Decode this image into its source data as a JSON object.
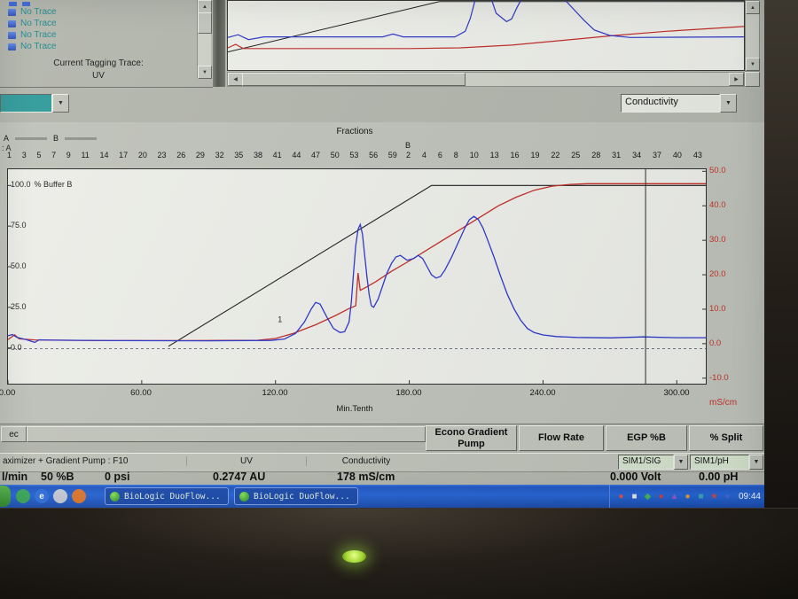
{
  "top_left_panel": {
    "items": [
      "No Trace",
      "No Trace",
      "No Trace",
      "No Trace"
    ],
    "tagging_label": "Current Tagging Trace:",
    "tagging_value": "UV"
  },
  "combos": {
    "left_value": "",
    "right_value": "Conductivity"
  },
  "main_chart": {
    "title": "Fractions",
    "legend_a": "A",
    "legend_b": "B",
    "rack_a_label": ": A",
    "rack_b_label": "B",
    "fractions_a": [
      "1",
      "3",
      "5",
      "7",
      "9",
      "11",
      "14",
      "17",
      "20",
      "23",
      "26",
      "29",
      "32",
      "35",
      "38",
      "41",
      "44",
      "47",
      "50",
      "53",
      "56",
      "59"
    ],
    "fractions_b": [
      "2",
      "4",
      "6",
      "8",
      "10",
      "13",
      "16",
      "19",
      "22",
      "25",
      "28",
      "31",
      "34",
      "37",
      "40",
      "43"
    ],
    "left_axis_top_value": "100.0",
    "left_axis_unit": "% Buffer B",
    "left_tick_75": "75.0",
    "left_tick_50": "50.0",
    "left_tick_25": "25.0",
    "left_tick_0": "0.0",
    "right_ticks": [
      "50.0",
      "40.0",
      "30.0",
      "20.0",
      "10.0",
      "0.0",
      "-10.0"
    ],
    "right_unit": "mS/cm",
    "x_ticks": [
      "0.00",
      "60.00",
      "120.00",
      "180.00",
      "240.00",
      "300.00"
    ],
    "x_label": "Min.Tenth"
  },
  "chart_data": [
    {
      "type": "line",
      "title": "Fractions",
      "x_label": "Min.Tenth",
      "x_range": [
        0,
        313
      ],
      "x_ticks": [
        0,
        60,
        120,
        180,
        240,
        300
      ],
      "left_axis": {
        "label": "% Buffer B",
        "range": [
          -22,
          110
        ],
        "ticks": [
          100,
          75,
          50,
          25,
          0
        ]
      },
      "right_axis": {
        "label": "mS/cm",
        "range": [
          -11.6,
          50.6
        ],
        "ticks": [
          50,
          40,
          30,
          20,
          10,
          0,
          -10
        ]
      },
      "series": [
        {
          "name": "buffer-b-gradient",
          "axis": "left",
          "color": "#1a1a1a",
          "width": 1.1,
          "points": [
            [
              72,
              1
            ],
            [
              190,
              100
            ],
            [
              313,
              100
            ]
          ]
        },
        {
          "name": "conductivity",
          "axis": "right",
          "color": "#c22a24",
          "width": 1.3,
          "points": [
            [
              0,
              1.2
            ],
            [
              3,
              2.6
            ],
            [
              5,
              1.4
            ],
            [
              12,
              1.1
            ],
            [
              40,
              0.9
            ],
            [
              80,
              0.9
            ],
            [
              112,
              1
            ],
            [
              120,
              1.5
            ],
            [
              128,
              3
            ],
            [
              138,
              5.5
            ],
            [
              147,
              8.2
            ],
            [
              153,
              10.2
            ],
            [
              156,
              11
            ],
            [
              157,
              20.5
            ],
            [
              158,
              15.5
            ],
            [
              161,
              16.5
            ],
            [
              165,
              18
            ],
            [
              172,
              21
            ],
            [
              180,
              24
            ],
            [
              190,
              28
            ],
            [
              200,
              32
            ],
            [
              210,
              36
            ],
            [
              220,
              40
            ],
            [
              228,
              42.5
            ],
            [
              236,
              44.5
            ],
            [
              244,
              45.7
            ],
            [
              252,
              46.2
            ],
            [
              260,
              46.4
            ],
            [
              313,
              46.4
            ]
          ]
        },
        {
          "name": "uv",
          "axis": "left",
          "color": "#2b35c8",
          "width": 1.3,
          "points": [
            [
              0,
              7.5
            ],
            [
              2,
              8.2
            ],
            [
              4,
              6.5
            ],
            [
              8,
              5.2
            ],
            [
              12,
              3.4
            ],
            [
              14,
              5
            ],
            [
              20,
              4.8
            ],
            [
              50,
              4.5
            ],
            [
              90,
              4.4
            ],
            [
              118,
              4.6
            ],
            [
              124,
              5.5
            ],
            [
              129,
              9
            ],
            [
              133,
              16
            ],
            [
              136,
              24
            ],
            [
              138,
              28
            ],
            [
              140,
              27
            ],
            [
              143,
              19
            ],
            [
              146,
              12
            ],
            [
              149,
              9.5
            ],
            [
              151,
              10
            ],
            [
              153,
              16
            ],
            [
              154,
              28
            ],
            [
              155,
              46
            ],
            [
              156,
              63
            ],
            [
              157,
              73
            ],
            [
              158,
              76
            ],
            [
              159,
              70
            ],
            [
              160,
              57
            ],
            [
              161,
              44
            ],
            [
              162,
              33
            ],
            [
              163,
              26
            ],
            [
              164,
              25
            ],
            [
              166,
              30
            ],
            [
              168,
              38
            ],
            [
              170,
              46
            ],
            [
              172,
              52
            ],
            [
              174,
              56
            ],
            [
              176,
              57
            ],
            [
              179,
              54
            ],
            [
              182,
              55
            ],
            [
              184,
              57
            ],
            [
              186,
              55
            ],
            [
              188,
              50
            ],
            [
              190,
              45
            ],
            [
              192,
              43
            ],
            [
              194,
              44
            ],
            [
              196,
              48
            ],
            [
              199,
              56
            ],
            [
              202,
              65
            ],
            [
              205,
              74
            ],
            [
              207,
              79
            ],
            [
              209,
              81
            ],
            [
              211,
              79
            ],
            [
              213,
              74
            ],
            [
              215,
              67
            ],
            [
              218,
              56
            ],
            [
              221,
              44
            ],
            [
              224,
              33
            ],
            [
              227,
              24
            ],
            [
              230,
              17
            ],
            [
              233,
              12
            ],
            [
              236,
              9.5
            ],
            [
              240,
              8
            ],
            [
              246,
              7
            ],
            [
              255,
              6.5
            ],
            [
              270,
              6.2
            ],
            [
              285,
              6.8
            ],
            [
              300,
              6.3
            ],
            [
              313,
              6.3
            ]
          ]
        },
        {
          "name": "zero-baseline",
          "axis": "left",
          "color": "#464c68",
          "width": 0.8,
          "dash": "3,3",
          "points": [
            [
              0,
              -0.5
            ],
            [
              313,
              -0.5
            ]
          ]
        },
        {
          "name": "cursor-line",
          "axis": "left",
          "color": "#2a2a2a",
          "width": 1,
          "points": [
            [
              286,
              -22
            ],
            [
              286,
              110
            ]
          ]
        }
      ],
      "annotations": [
        {
          "x": 121,
          "y": 16,
          "text": "1",
          "color": "#222222"
        }
      ]
    },
    {
      "type": "line",
      "title": "overview",
      "x_range": [
        0,
        100
      ],
      "left_axis": {
        "range": [
          100,
          0
        ]
      },
      "series": [
        {
          "name": "gradient",
          "color": "#1a1a1a",
          "width": 1,
          "points": [
            [
              0,
              74
            ],
            [
              41,
              1
            ],
            [
              100,
              1
            ]
          ]
        },
        {
          "name": "conductivity",
          "color": "#c22a24",
          "width": 1.2,
          "points": [
            [
              0,
              68
            ],
            [
              1.5,
              63
            ],
            [
              3,
              69
            ],
            [
              35,
              69
            ],
            [
              45,
              68
            ],
            [
              55,
              64
            ],
            [
              65,
              57
            ],
            [
              75,
              50
            ],
            [
              85,
              44
            ],
            [
              100,
              37
            ]
          ]
        },
        {
          "name": "uv",
          "color": "#2b35c8",
          "width": 1.2,
          "points": [
            [
              0,
              53
            ],
            [
              2,
              49
            ],
            [
              4,
              56
            ],
            [
              7,
              52
            ],
            [
              30,
              52
            ],
            [
              32,
              48
            ],
            [
              34,
              52
            ],
            [
              44,
              52
            ],
            [
              46,
              44
            ],
            [
              47,
              25
            ],
            [
              48,
              -4
            ],
            [
              51,
              -4
            ],
            [
              52,
              18
            ],
            [
              54,
              30
            ],
            [
              55,
              26
            ],
            [
              56,
              10
            ],
            [
              57,
              -4
            ],
            [
              65,
              -4
            ],
            [
              67,
              12
            ],
            [
              69,
              28
            ],
            [
              71,
              42
            ],
            [
              74,
              50
            ],
            [
              78,
              53
            ],
            [
              100,
              52
            ]
          ]
        }
      ]
    }
  ],
  "status_panel": {
    "tab_label": "ec",
    "headers": [
      "Econo Gradient Pump",
      "Flow Rate",
      "EGP %B",
      "% Split"
    ],
    "device_pump": "aximizer + Gradient Pump : F10",
    "device_uv": "UV",
    "device_cond": "Conductivity",
    "sim_sig": "SIM1/SIG",
    "sim_ph": "SIM1/pH",
    "value_flow_unit": "l/min",
    "value_percent_b": "50 %B",
    "value_pressure": "0 psi",
    "value_uv": "0.2747 AU",
    "value_cond": "178 mS/cm",
    "value_volt": "0.000 Volt",
    "value_ph": "0.00 pH"
  },
  "taskbar": {
    "window_buttons": [
      "BioLogic DuoFlow...",
      "BioLogic DuoFlow..."
    ],
    "clock": "09:44",
    "quick_launch_icons": [
      {
        "name": "quick-launch-icon",
        "glyph": "●",
        "color": "#3aa85c"
      },
      {
        "name": "ie-icon",
        "glyph": "e",
        "color": "#3070dc"
      },
      {
        "name": "quick-launch-icon",
        "glyph": "■",
        "color": "#c8ccd8"
      },
      {
        "name": "quick-launch-icon",
        "glyph": "●",
        "color": "#e07830"
      }
    ],
    "tray_icons": [
      {
        "name": "tray-icon",
        "glyph": "●",
        "color": "#e05050"
      },
      {
        "name": "tray-icon",
        "glyph": "■",
        "color": "#e8e8ee"
      },
      {
        "name": "tray-icon",
        "glyph": "◆",
        "color": "#48b858"
      },
      {
        "name": "tray-icon",
        "glyph": "●",
        "color": "#d04040"
      },
      {
        "name": "tray-icon",
        "glyph": "▲",
        "color": "#9858c8"
      },
      {
        "name": "tray-icon",
        "glyph": "●",
        "color": "#e8a030"
      },
      {
        "name": "tray-icon",
        "glyph": "■",
        "color": "#38a8b8"
      },
      {
        "name": "tray-icon",
        "glyph": "★",
        "color": "#d04848"
      },
      {
        "name": "tray-icon",
        "glyph": "●",
        "color": "#4868d0"
      }
    ]
  }
}
